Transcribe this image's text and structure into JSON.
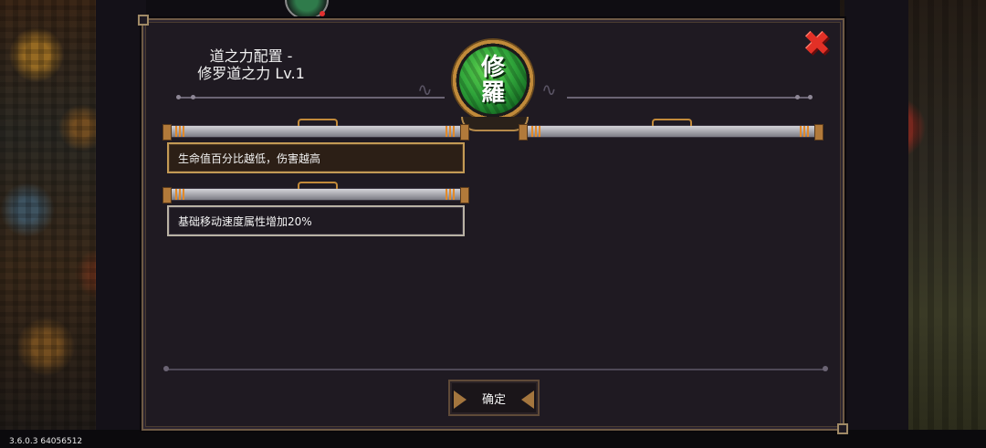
{
  "window": {
    "version": "3.6.0.3 64056512"
  },
  "dialog": {
    "title_line1": "道之力配置 -",
    "title_line2": "修罗道之力 Lv.1",
    "close_glyph": "✖",
    "emblem_chars": [
      "修",
      "羅"
    ],
    "effects": [
      {
        "text": "生命值百分比越低，伤害越高",
        "selected": true
      },
      {
        "text": "基础移动速度属性增加20%",
        "selected": false
      }
    ],
    "confirm_label": "确定"
  },
  "colors": {
    "accent_gold": "#c39a55",
    "close_red": "#e23026",
    "emblem_green": "#2fa43a"
  }
}
